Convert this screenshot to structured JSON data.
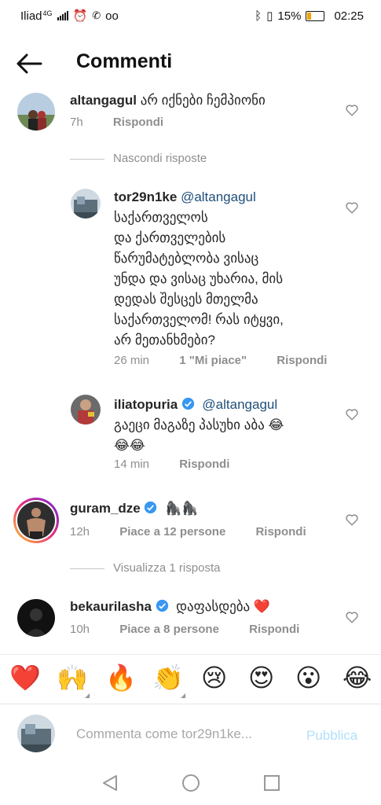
{
  "status_bar": {
    "carrier": "Iliad",
    "network": "4G",
    "battery": "15%",
    "time": "02:25"
  },
  "header": {
    "title": "Commenti"
  },
  "comments": [
    {
      "username": "altangagul",
      "text": "არ იქნები ჩემპიონი",
      "time": "7h",
      "reply_label": "Rispondi",
      "hide_replies_label": "Nascondi risposte",
      "replies": [
        {
          "username": "tor29n1ke",
          "mention": "@altangagul",
          "text_lines": [
            "საქართველოს",
            "და ქართველების",
            "წარუმატებლობა ვისაც",
            "უნდა და ვისაც უხარია, მის",
            "დედას შესცეს მთელმა",
            "საქართველომ! რას იტყვი,",
            "არ მეთანხმები?"
          ],
          "time": "26 min",
          "likes": "1 \"Mi piace\"",
          "reply_label": "Rispondi"
        },
        {
          "username": "iliatopuria",
          "mention": "@altangagul",
          "text_line1": "გაეცი მაგაზე პასუხი აბა 😂",
          "text_line2": "😂😂",
          "time": "14 min",
          "reply_label": "Rispondi"
        }
      ]
    },
    {
      "username": "guram_dze",
      "text": "🦍🦍",
      "time": "12h",
      "likes": "Piace a 12 persone",
      "reply_label": "Rispondi",
      "view_replies_label": "Visualizza 1 risposta"
    },
    {
      "username": "bekaurilasha",
      "text": "დაფასდება ❤️",
      "time": "10h",
      "likes": "Piace a 8 persone",
      "reply_label": "Rispondi"
    }
  ],
  "emoji_bar": [
    "❤️",
    "🙌",
    "🔥",
    "👏",
    "😢",
    "😍",
    "😮",
    "😂"
  ],
  "composer": {
    "placeholder": "Commenta come tor29n1ke...",
    "publish_label": "Pubblica"
  },
  "colors": {
    "verified": "#3897f0",
    "publish": "#b2dffc",
    "muted_text": "#8e8e8e",
    "mention": "#1f4f7a"
  }
}
